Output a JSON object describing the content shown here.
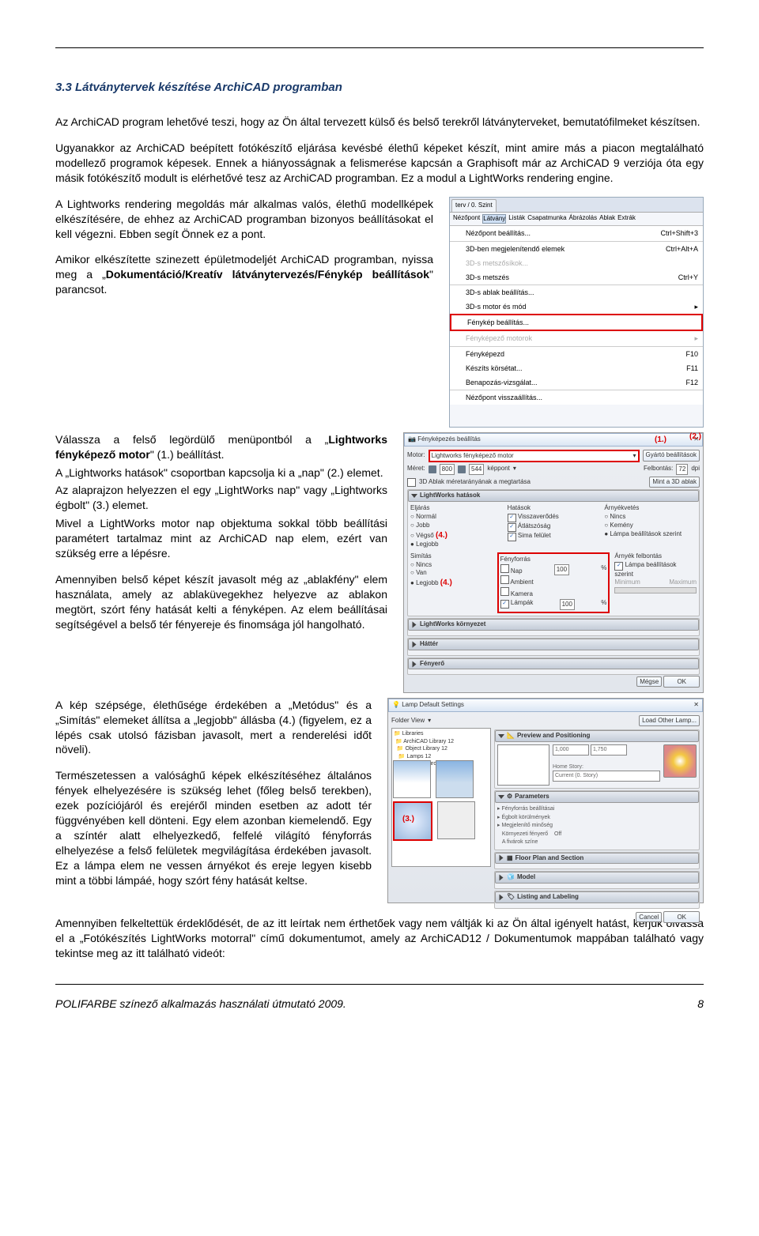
{
  "heading": "3.3 Látványtervek készítése ArchiCAD programban",
  "paragraphs": {
    "p1": "Az ArchiCAD program lehetővé teszi, hogy az Ön által tervezett külső és belső terekről látványterveket, bemutatófilmeket készítsen.",
    "p2": "Ugyanakkor az ArchiCAD beépített fotókészítő eljárása kevésbé élethű képeket készít, mint amire más a piacon megtalálható modellező programok képesek. Ennek a hiányosságnak a felismerése kapcsán a Graphisoft már az ArchiCAD 9 verziója óta egy másik fotókészítő modult is elérhetővé tesz az ArchiCAD programban. Ez a modul a LightWorks rendering engine.",
    "p3": "A Lightworks rendering megoldás már alkalmas valós, élethű modellképek elkészítésére, de ehhez az ArchiCAD programban bizonyos beállításokat el kell végezni. Ebben segít Önnek ez a pont.",
    "p4a": "Amikor elkészítette szinezett épületmodeljét ArchiCAD programban, nyissa meg a „",
    "p4b": "Dokumentáció/Kreatív látványtervezés/Fénykép beállítások",
    "p4c": "\" parancsot.",
    "p5a": "Válassza a felső legördülő menüpontból a „",
    "p5b": "Lightworks fényképező motor",
    "p5c": "\" (1.) beállítást.",
    "p6": "A „Lightworks hatások\" csoportban kapcsolja ki a „nap\" (2.) elemet.",
    "p7": "Az alaprajzon helyezzen el egy „LightWorks nap\" vagy „Lightworks égbolt\" (3.) elemet.",
    "p8": "Mivel a LightWorks motor nap objektuma sokkal több beállítási paramétert tartalmaz mint az ArchiCAD nap elem, ezért van szükség erre a lépésre.",
    "p9": "Amennyiben belső képet készít javasolt még az „ablakfény\" elem használata, amely az ablaküvegekhez helyezve az ablakon megtört, szórt fény hatását kelti a fényképen. Az elem beállításai segítségével a belső tér fényereje és finomsága jól hangolható.",
    "p10": "A kép szépsége, élethűsége érdekében a „Metódus\" és a „Simítás\" elemeket állítsa a „legjobb\" állásba (4.) (figyelem, ez a lépés csak utolsó fázisban javasolt, mert a renderelési időt növeli).",
    "p11": "Természetessen a valósághű képek elkészítéséhez általános fények elhelyezésére is szükség lehet (főleg belső terekben), ezek pozíciójáról és erejéről minden esetben az adott tér függvényében kell dönteni. Egy elem azonban kiemelendő. Egy a színtér alatt elhelyezkedő, felfelé világító fényforrás elhelyezése a felső felületek megvilágítása érdekében javasolt. Ez a lámpa elem ne vessen árnyékot és ereje legyen kisebb mint a többi lámpáé, hogy szórt fény hatását keltse.",
    "p12": "Amennyiben felkeltettük érdeklődését, de az itt leírtak nem érthetőek vagy nem váltják ki az Ön által igényelt hatást, kérjük olvassa el a „Fotókészítés LightWorks motorral\" című dokumentumot, amely az ArchiCAD12 / Dokumentumok mappában található vagy tekintse meg az itt található videót:"
  },
  "menu_panel": {
    "tabs": [
      "terv / 0. Szint"
    ],
    "header_tabs": [
      "Nézőpont",
      "Látvány",
      "Listák",
      "Csapatmunka",
      "Ábrázolás",
      "Ablak",
      "Extrák"
    ],
    "items": [
      {
        "label": "Nézőpont beállítás...",
        "shortcut": "Ctrl+Shift+3"
      },
      {
        "label": "3D-ben megjelenítendő elemek",
        "shortcut": "Ctrl+Alt+A"
      },
      {
        "label": "3D-s metszősíkok...",
        "shortcut": ""
      },
      {
        "label": "3D-s metszés",
        "shortcut": "Ctrl+Y"
      },
      {
        "label": "3D-s ablak beállítás...",
        "shortcut": ""
      },
      {
        "label": "3D-s motor és mód",
        "shortcut": "▸"
      },
      {
        "label": "Fénykép beállítás...",
        "shortcut": "",
        "hl": true
      },
      {
        "label": "Fényképező motorok",
        "shortcut": "▸"
      },
      {
        "label": "Fényképezd",
        "shortcut": "F10"
      },
      {
        "label": "Készíts körsétat...",
        "shortcut": "F11"
      },
      {
        "label": "Benapozás-vizsgálat...",
        "shortcut": "F12"
      },
      {
        "label": "Nézőpont visszaállítás...",
        "shortcut": ""
      }
    ]
  },
  "dialog2": {
    "title": "Fényképezés beállítás",
    "motor_label": "Motor:",
    "motor_value": "Lightworks fényképező motor",
    "gyarto": "Gyártó beállítások",
    "meret": "Méret:",
    "w": "800",
    "h": "544",
    "unit": "képpont",
    "felbontas": "Felbontás:",
    "dpi": "72",
    "dpi_unit": "dpi",
    "chk1": "3D Ablak méretarányának a megtartása",
    "mint": "Mint a 3D ablak",
    "group_hatások": "LightWorks hatások",
    "eljaras": "Eljárás",
    "hatások": "Hatások",
    "arnyekvetés": "Árnyékvetés",
    "proc": [
      "Normál",
      "Jobb",
      "Végső",
      "Legjobb"
    ],
    "hat": [
      "Visszaverődés",
      "Átlátszóság",
      "Sima felület"
    ],
    "arny": [
      "Nincs",
      "Kemény",
      "Lámpa beállítások szerint"
    ],
    "fenyforras": "Fényforrás",
    "arnyfel": "Árnyék felbontás",
    "nap": "Nap",
    "ff": [
      "Nincs",
      "Van",
      "Legjobb"
    ],
    "kamera": "Kamera",
    "lampak": "Lámpák",
    "minimum": "Minimum",
    "maximum": "Maximum",
    "group_korny": "LightWorks környezet",
    "hatter": "Háttér",
    "fenyero": "Fényerő",
    "megse": "Mégse",
    "ok": "OK",
    "labels": {
      "l1": "(1.)",
      "l2": "(2.)",
      "l4a": "(4.)",
      "l4b": "(4.)"
    }
  },
  "dialog3": {
    "title": "Lamp Default Settings",
    "folder": "Folder View",
    "load": "Load Other Lamp...",
    "lib": "Libraries",
    "preview": "Preview and Positioning",
    "label3": "(3.)",
    "params": "Parameters",
    "groups": [
      "Floor Plan and Section",
      "Model",
      "Listing and Labeling"
    ],
    "cancel": "Cancel",
    "ok": "OK"
  },
  "footer": {
    "left": "POLIFARBE színező alkalmazás használati útmutató 2009.",
    "right": "8"
  }
}
